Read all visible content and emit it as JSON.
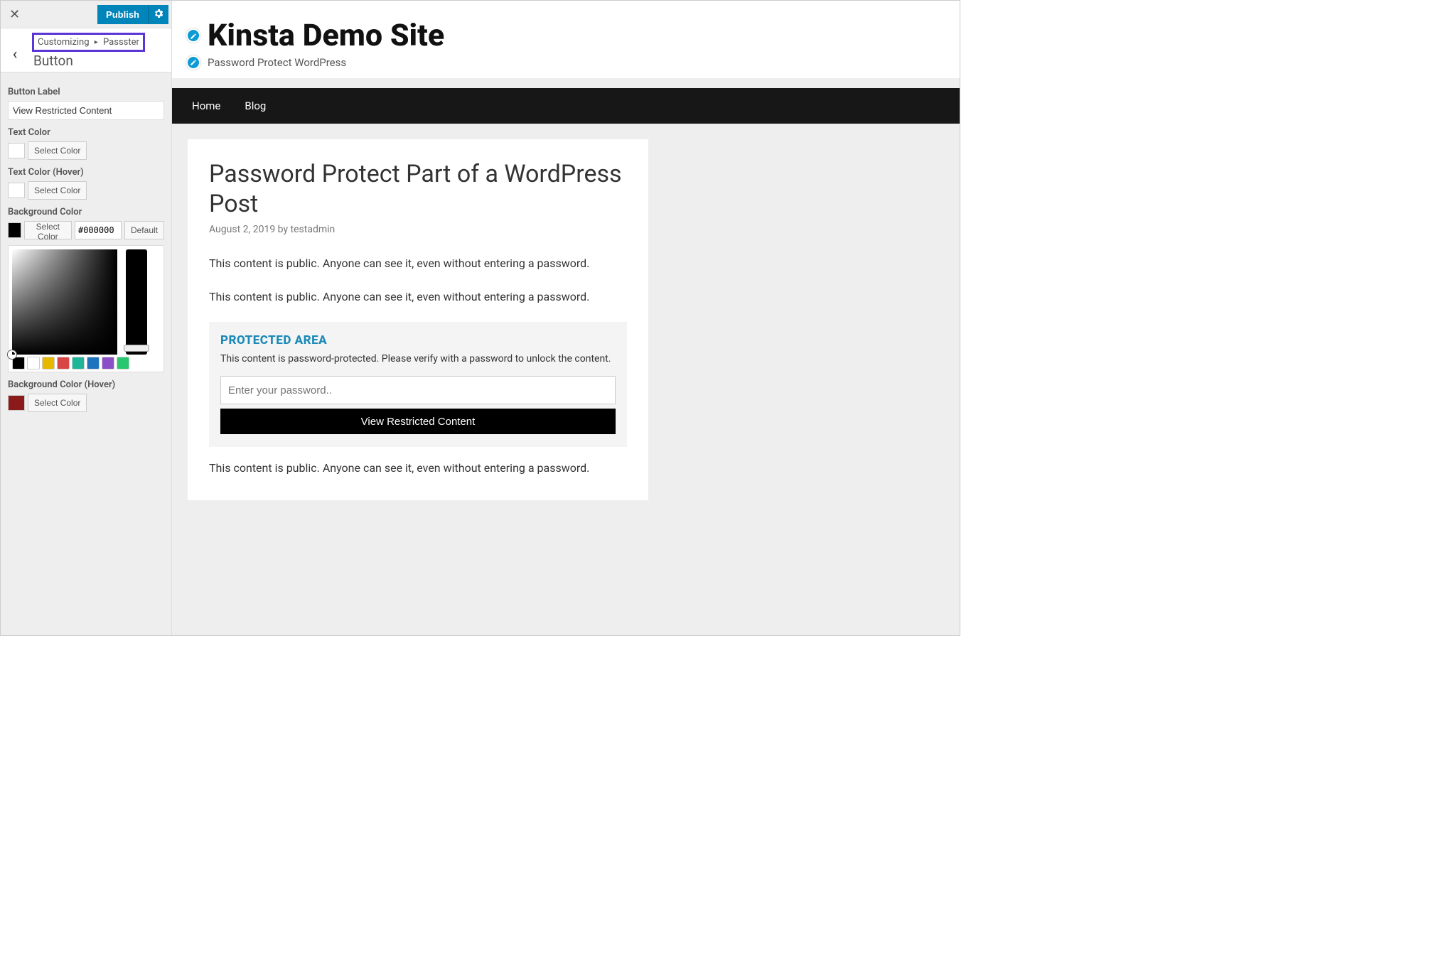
{
  "sidebar": {
    "publish_label": "Publish",
    "breadcrumb": {
      "root": "Customizing",
      "section": "Passster"
    },
    "panel_title": "Button",
    "controls": {
      "button_label": {
        "label": "Button Label",
        "value": "View Restricted Content"
      },
      "text_color": {
        "label": "Text Color",
        "select_label": "Select Color"
      },
      "text_color_hover": {
        "label": "Text Color (Hover)",
        "select_label": "Select Color"
      },
      "bg_color": {
        "label": "Background Color",
        "select_label": "Select Color",
        "hex": "#000000",
        "default_label": "Default",
        "palette": [
          "#000000",
          "#ffffff",
          "#e6b800",
          "#d94545",
          "#1fb598",
          "#1e73be",
          "#8a4fc7",
          "#28c76f"
        ]
      },
      "bg_color_hover": {
        "label": "Background Color (Hover)",
        "select_label": "Select Color"
      }
    }
  },
  "preview": {
    "site_title": "Kinsta Demo Site",
    "tagline": "Password Protect WordPress",
    "nav": [
      "Home",
      "Blog"
    ],
    "post": {
      "title": "Password Protect Part of a WordPress Post",
      "meta": "August 2, 2019 by testadmin",
      "paragraphs": [
        "This content is public. Anyone can see it, even without entering a password.",
        "This content is public. Anyone can see it, even without entering a password.",
        "This content is public. Anyone can see it, even without entering a password."
      ],
      "protected": {
        "heading": "PROTECTED AREA",
        "text": "This content is password-protected. Please verify with a password to unlock the content.",
        "placeholder": "Enter your password..",
        "button": "View Restricted Content"
      }
    }
  }
}
